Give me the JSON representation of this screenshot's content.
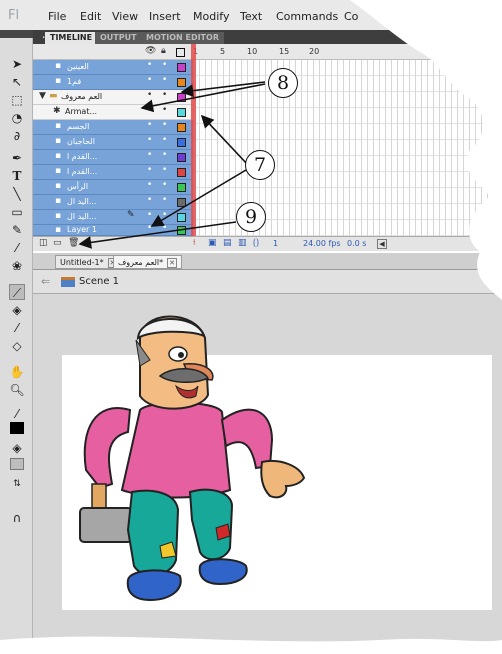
{
  "app_logo": "Fl",
  "menu": [
    "File",
    "Edit",
    "View",
    "Insert",
    "Modify",
    "Text",
    "Commands",
    "Co"
  ],
  "panel_tabs": [
    "TIMELINE",
    "OUTPUT",
    "MOTION EDITOR"
  ],
  "frame_numbers": [
    "1",
    "5",
    "10",
    "15",
    "20"
  ],
  "layers": [
    {
      "name": "العينين",
      "kind": "layer",
      "color": "#c940c9"
    },
    {
      "name": "فم1",
      "kind": "layer",
      "color": "#e8861e"
    },
    {
      "name": "العم معروف",
      "kind": "folder",
      "color": "#c940c9"
    },
    {
      "name": "Armat...",
      "kind": "armature",
      "color": "#5ad6e0"
    },
    {
      "name": "الجسم",
      "kind": "layer",
      "color": "#e8861e"
    },
    {
      "name": "الحاجبان",
      "kind": "layer",
      "color": "#3a6fe0"
    },
    {
      "name": "القدم ا...",
      "kind": "layer",
      "color": "#6d3fd1"
    },
    {
      "name": "القدم ا...",
      "kind": "layer",
      "color": "#e04545"
    },
    {
      "name": "الرأس",
      "kind": "layer",
      "color": "#3dc456"
    },
    {
      "name": "اليد ال...",
      "kind": "layer",
      "color": "#6b6b6b"
    },
    {
      "name": "اليد ال...",
      "kind": "layer",
      "color": "#5ad6e0"
    },
    {
      "name": "Layer 1",
      "kind": "layer",
      "color": "#3dc456"
    }
  ],
  "status": {
    "frame": "1",
    "fps": "24.00 fps",
    "time": "0.0 s"
  },
  "doc_tabs": [
    "Untitled-1*",
    "العم معروف*"
  ],
  "scene_label": "Scene 1",
  "callouts": [
    "8",
    "7",
    "9"
  ],
  "icons": [
    "arrow-tool-icon",
    "subselect-tool-icon",
    "free-transform-icon",
    "lasso-icon",
    "pen-icon",
    "text-tool-icon",
    "line-tool-icon",
    "rectangle-tool-icon",
    "pencil-icon",
    "brush-icon",
    "bone-tool-icon",
    "paint-bucket-icon",
    "eyedropper-icon",
    "eraser-icon",
    "hand-icon",
    "zoom-icon",
    "stroke-color-icon",
    "fill-color-icon",
    "swap-colors-icon",
    "snap-magnet-icon",
    "eye-icon",
    "lock-icon",
    "outline-icon"
  ]
}
